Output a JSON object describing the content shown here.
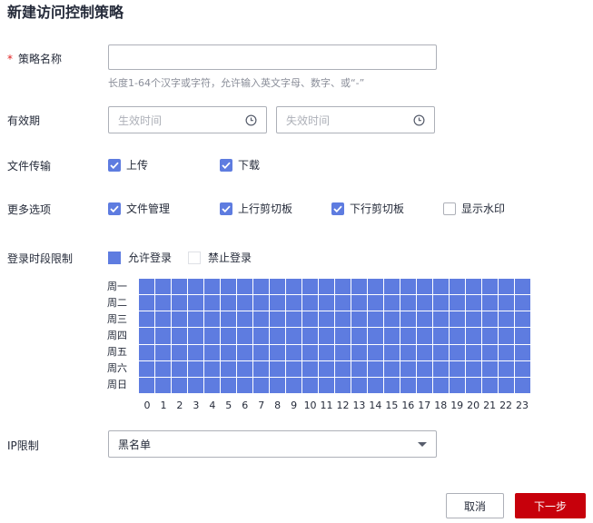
{
  "title": "新建访问控制策略",
  "policy_name": {
    "required_mark": "*",
    "label": "策略名称",
    "value": "",
    "hint": "长度1-64个汉字或字符，允许输入英文字母、数字、或“-”"
  },
  "validity": {
    "label": "有效期",
    "start_placeholder": "生效时间",
    "end_placeholder": "失效时间",
    "icon": "clock-icon"
  },
  "file_transfer": {
    "label": "文件传输",
    "options": [
      {
        "label": "上传",
        "checked": true
      },
      {
        "label": "下载",
        "checked": true
      }
    ]
  },
  "more_options": {
    "label": "更多选项",
    "options": [
      {
        "label": "文件管理",
        "checked": true
      },
      {
        "label": "上行剪切板",
        "checked": true
      },
      {
        "label": "下行剪切板",
        "checked": true
      },
      {
        "label": "显示水印",
        "checked": false
      }
    ]
  },
  "login_period": {
    "label": "登录时段限制",
    "legend_allow": "允许登录",
    "legend_deny": "禁止登录",
    "days": [
      "周一",
      "周二",
      "周三",
      "周四",
      "周五",
      "周六",
      "周日"
    ],
    "hours": [
      "0",
      "1",
      "2",
      "3",
      "4",
      "5",
      "6",
      "7",
      "8",
      "9",
      "10",
      "11",
      "12",
      "13",
      "14",
      "15",
      "16",
      "17",
      "18",
      "19",
      "20",
      "21",
      "22",
      "23"
    ],
    "all_allowed": true
  },
  "ip_limit": {
    "label": "IP限制",
    "selected": "黑名单"
  },
  "buttons": {
    "cancel": "取消",
    "next": "下一步"
  },
  "colors": {
    "accent": "#5e7ce0",
    "primary_button": "#c7000b"
  }
}
